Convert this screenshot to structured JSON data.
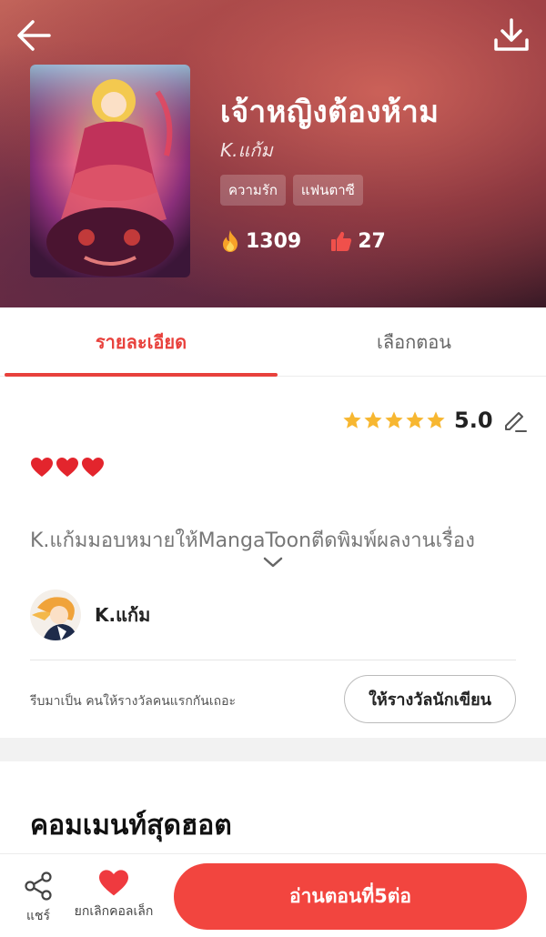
{
  "header": {
    "title": "เจ้าหญิงต้องห้าม",
    "author": "K.แก้ม",
    "tags": [
      "ความรัก",
      "แฟนตาซี"
    ],
    "views": "1309",
    "likes": "27"
  },
  "tabs": [
    {
      "label": "รายละเอียด",
      "active": true
    },
    {
      "label": "เลือกตอน",
      "active": false
    }
  ],
  "details": {
    "rating": "5.0",
    "stars": 5,
    "description": "K.แก้มมอบหมายให้MangaToonตีดพิมพ์ผลงานเรื่อง",
    "author_name": "K.แก้ม",
    "reward_prompt": "รีบมาเป็น คนให้รางวัลคนแรกกันเถอะ",
    "reward_button": "ให้รางวัลนักเขียน",
    "hot_comments_title": "คอมเมนท์สุดฮอต"
  },
  "bottom_bar": {
    "share_label": "แชร์",
    "favorite_label": "ยกเลิกคอลเล็ก",
    "read_button": "อ่านตอนที่5ต่อ"
  },
  "colors": {
    "accent": "#e8413c",
    "read_button": "#f2453f",
    "star": "#f7b731"
  },
  "icons": [
    "back-arrow-icon",
    "download-icon",
    "fire-icon",
    "thumbs-up-icon",
    "star-icon",
    "edit-pencil-icon",
    "heart-icon",
    "chevron-down-icon",
    "share-icon"
  ]
}
